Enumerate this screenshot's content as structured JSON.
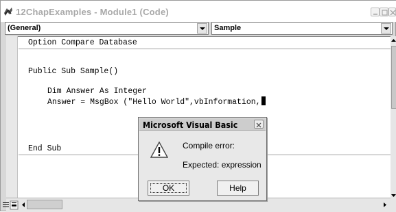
{
  "window": {
    "title": "12ChapExamples - Module1 (Code)"
  },
  "toolbar": {
    "object_combo": "(General)",
    "procedure_combo": "Sample"
  },
  "code": {
    "lines": [
      "Option Compare Database",
      "Public Sub Sample()",
      "Dim Answer As Integer",
      "Answer = MsgBox (\"Hello World\",vbInformation,",
      "End Sub"
    ]
  },
  "dialog": {
    "title": "Microsoft Visual Basic",
    "message_line1": "Compile error:",
    "message_line2": "Expected: expression",
    "ok_label": "OK",
    "help_label": "Help",
    "icon": "warning-icon"
  },
  "colors": {
    "title_text": "#a8a8a8",
    "editor_bg": "#ffffff",
    "dialog_bg": "#e8e8e8"
  }
}
